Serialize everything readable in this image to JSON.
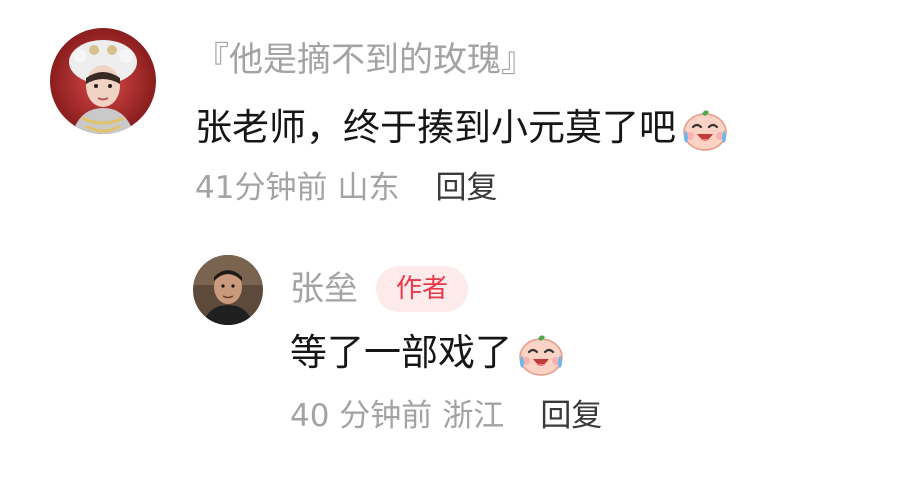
{
  "comment": {
    "username": "『他是摘不到的玫瑰』",
    "text": "张老师，终于揍到小元莫了吧",
    "emoji": "laugh-cry-emoji",
    "time": "41分钟前",
    "location": "山东",
    "reply_label": "回复"
  },
  "reply": {
    "username": "张垒",
    "badge": "作者",
    "text": "等了一部戏了",
    "emoji": "laugh-cry-emoji",
    "time": "40 分钟前",
    "location": "浙江",
    "reply_label": "回复"
  },
  "colors": {
    "username": "#a3a3a3",
    "text": "#161616",
    "meta": "#a3a3a3",
    "reply_link": "#3a3a3a",
    "badge_bg": "#fdeaea",
    "badge_text": "#e8394a"
  }
}
